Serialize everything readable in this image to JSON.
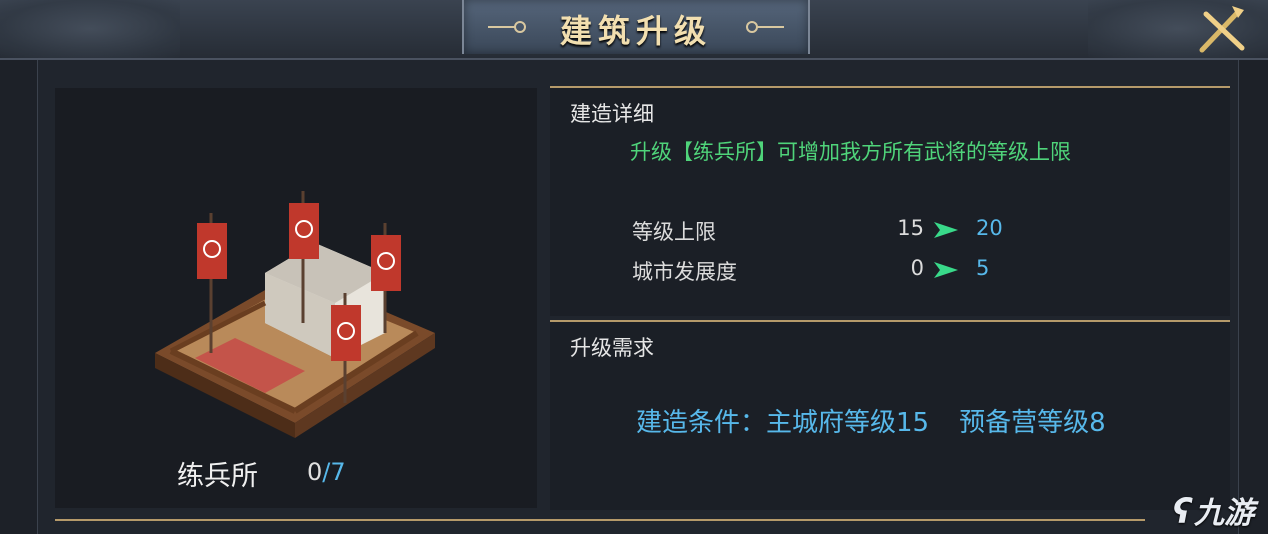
{
  "header": {
    "title": "建筑升级"
  },
  "building": {
    "name": "练兵所",
    "current": "0",
    "max": "/7"
  },
  "detail": {
    "title": "建造详细",
    "description": "升级【练兵所】可增加我方所有武将的等级上限",
    "stats": [
      {
        "label": "等级上限",
        "current": "15",
        "next": "20"
      },
      {
        "label": "城市发展度",
        "current": "0",
        "next": "5"
      }
    ]
  },
  "requirements": {
    "title": "升级需求",
    "label": "建造条件：",
    "items": [
      "主城府等级15",
      "预备营等级8"
    ]
  },
  "watermark": {
    "icon": "九游-logo",
    "text": "九游"
  },
  "colors": {
    "accent_gold": "#b59a6a",
    "value_blue": "#57b8ea",
    "desc_green": "#4fd47a",
    "arrow_green": "#39d98a"
  }
}
